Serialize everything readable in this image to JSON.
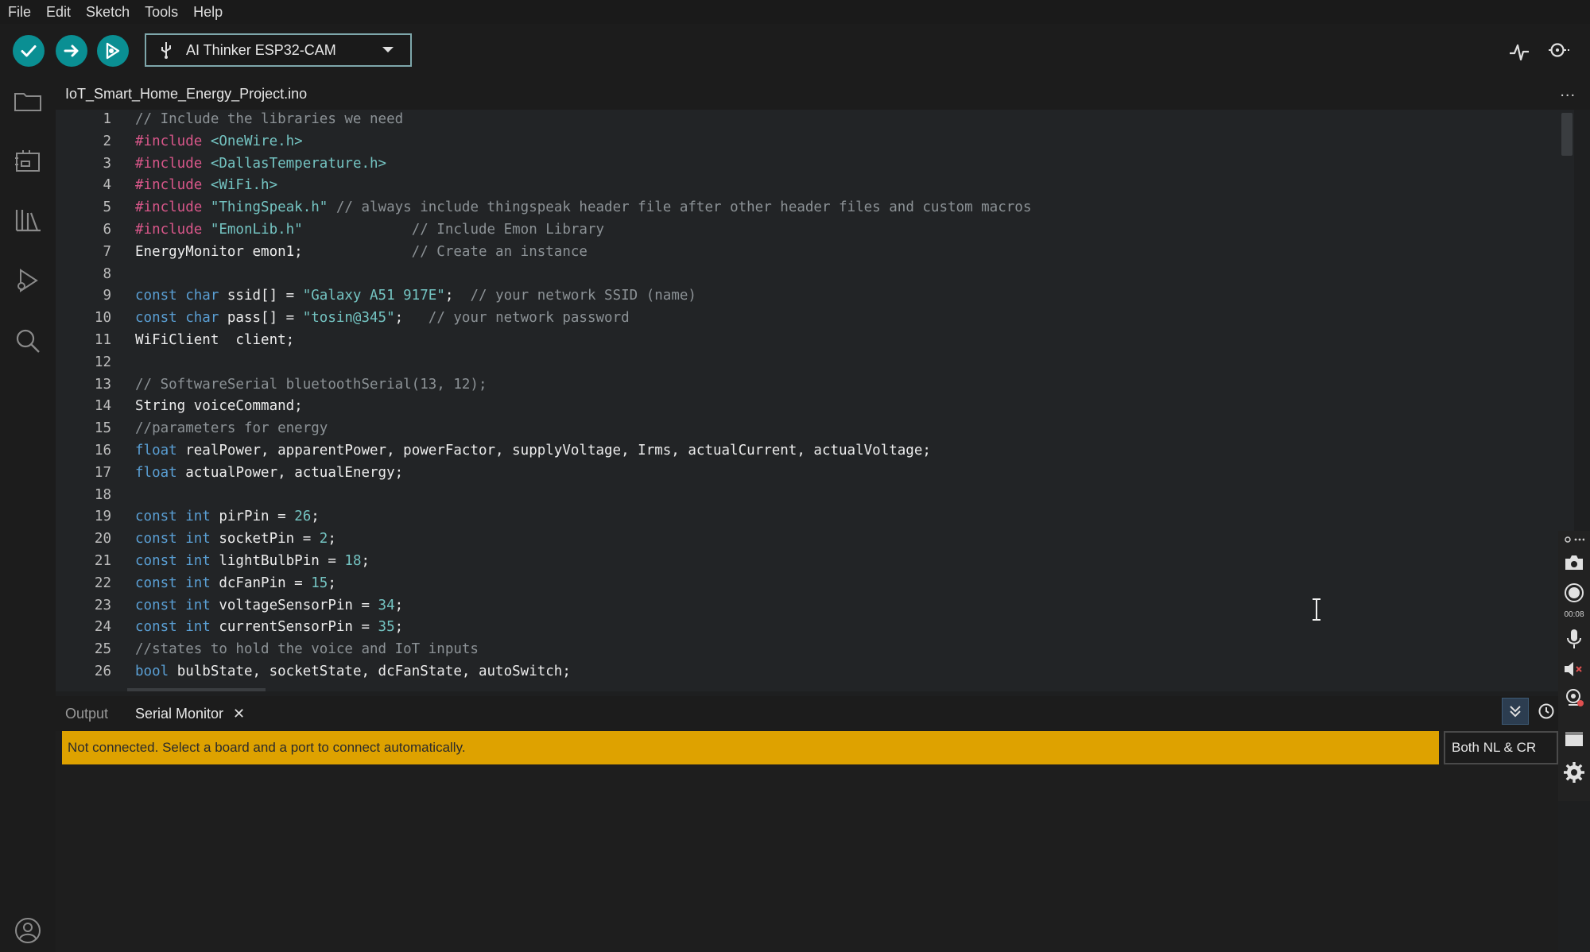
{
  "menu": [
    "File",
    "Edit",
    "Sketch",
    "Tools",
    "Help"
  ],
  "toolbar": {
    "board_label": "AI Thinker ESP32-CAM",
    "verify_icon": "check-icon",
    "upload_icon": "arrow-right-icon",
    "debug_icon": "debug-icon",
    "serial_plotter_icon": "pulse-icon",
    "serial_monitor_icon": "magnifier-icon"
  },
  "sidebar": {
    "items": [
      "folder-icon",
      "board-manager-icon",
      "library-icon",
      "debug-icon",
      "search-icon"
    ],
    "account_icon": "user-icon"
  },
  "editor": {
    "tab_title": "IoT_Smart_Home_Energy_Project.ino",
    "tab_more": "...",
    "lines": [
      {
        "n": "1",
        "tokens": [
          [
            "cm",
            "// Include the libraries we need"
          ]
        ]
      },
      {
        "n": "2",
        "tokens": [
          [
            "pp",
            "#include "
          ],
          [
            "str",
            "<OneWire.h>"
          ]
        ]
      },
      {
        "n": "3",
        "tokens": [
          [
            "pp",
            "#include "
          ],
          [
            "str",
            "<DallasTemperature.h>"
          ]
        ]
      },
      {
        "n": "4",
        "tokens": [
          [
            "pp",
            "#include "
          ],
          [
            "str",
            "<WiFi.h>"
          ]
        ]
      },
      {
        "n": "5",
        "tokens": [
          [
            "pp",
            "#include "
          ],
          [
            "str",
            "\"ThingSpeak.h\""
          ],
          [
            "cm",
            " // always include thingspeak header file after other header files and custom macros"
          ]
        ]
      },
      {
        "n": "6",
        "tokens": [
          [
            "pp",
            "#include "
          ],
          [
            "str",
            "\"EmonLib.h\""
          ],
          [
            "cm",
            "             // Include Emon Library"
          ]
        ]
      },
      {
        "n": "7",
        "tokens": [
          [
            "tx",
            "EnergyMonitor emon1;"
          ],
          [
            "cm",
            "             // Create an instance"
          ]
        ]
      },
      {
        "n": "8",
        "tokens": []
      },
      {
        "n": "9",
        "tokens": [
          [
            "kw",
            "const char"
          ],
          [
            "tx",
            " ssid[] = "
          ],
          [
            "str",
            "\"Galaxy A51 917E\""
          ],
          [
            "tx",
            ";"
          ],
          [
            "cm",
            "  // your network SSID (name)"
          ]
        ]
      },
      {
        "n": "10",
        "tokens": [
          [
            "kw",
            "const char"
          ],
          [
            "tx",
            " pass[] = "
          ],
          [
            "str",
            "\"tosin@345\""
          ],
          [
            "tx",
            ";"
          ],
          [
            "cm",
            "   // your network password"
          ]
        ]
      },
      {
        "n": "11",
        "tokens": [
          [
            "tx",
            "WiFiClient  client;"
          ]
        ]
      },
      {
        "n": "12",
        "tokens": []
      },
      {
        "n": "13",
        "tokens": [
          [
            "cm",
            "// SoftwareSerial bluetoothSerial(13, 12);"
          ]
        ]
      },
      {
        "n": "14",
        "tokens": [
          [
            "tx",
            "String voiceCommand;"
          ]
        ]
      },
      {
        "n": "15",
        "tokens": [
          [
            "cm",
            "//parameters for energy"
          ]
        ]
      },
      {
        "n": "16",
        "tokens": [
          [
            "kw",
            "float"
          ],
          [
            "tx",
            " realPower, apparentPower, powerFactor, supplyVoltage, Irms, actualCurrent, actualVoltage;"
          ]
        ]
      },
      {
        "n": "17",
        "tokens": [
          [
            "kw",
            "float"
          ],
          [
            "tx",
            " actualPower, actualEnergy;"
          ]
        ]
      },
      {
        "n": "18",
        "tokens": []
      },
      {
        "n": "19",
        "tokens": [
          [
            "kw",
            "const int"
          ],
          [
            "tx",
            " pirPin = "
          ],
          [
            "num",
            "26"
          ],
          [
            "tx",
            ";"
          ]
        ]
      },
      {
        "n": "20",
        "tokens": [
          [
            "kw",
            "const int"
          ],
          [
            "tx",
            " socketPin = "
          ],
          [
            "num",
            "2"
          ],
          [
            "tx",
            ";"
          ]
        ]
      },
      {
        "n": "21",
        "tokens": [
          [
            "kw",
            "const int"
          ],
          [
            "tx",
            " lightBulbPin = "
          ],
          [
            "num",
            "18"
          ],
          [
            "tx",
            ";"
          ]
        ]
      },
      {
        "n": "22",
        "tokens": [
          [
            "kw",
            "const int"
          ],
          [
            "tx",
            " dcFanPin = "
          ],
          [
            "num",
            "15"
          ],
          [
            "tx",
            ";"
          ]
        ]
      },
      {
        "n": "23",
        "tokens": [
          [
            "kw",
            "const int"
          ],
          [
            "tx",
            " voltageSensorPin = "
          ],
          [
            "num",
            "34"
          ],
          [
            "tx",
            ";"
          ]
        ]
      },
      {
        "n": "24",
        "tokens": [
          [
            "kw",
            "const int"
          ],
          [
            "tx",
            " currentSensorPin = "
          ],
          [
            "num",
            "35"
          ],
          [
            "tx",
            ";"
          ]
        ]
      },
      {
        "n": "25",
        "tokens": [
          [
            "cm",
            "//states to hold the voice and IoT inputs"
          ]
        ]
      },
      {
        "n": "26",
        "tokens": [
          [
            "kw",
            "bool"
          ],
          [
            "tx",
            " bulbState, socketState, dcFanState, autoSwitch;"
          ]
        ]
      }
    ]
  },
  "panel": {
    "tab_output": "Output",
    "tab_serial": "Serial Monitor",
    "close_glyph": "✕",
    "status_message": "Not connected. Select a board and a port to connect automatically.",
    "line_ending": "Both NL & CR"
  },
  "recorder": {
    "time": "00:08"
  },
  "colors": {
    "accent": "#0a8f93",
    "warning": "#dea200"
  }
}
